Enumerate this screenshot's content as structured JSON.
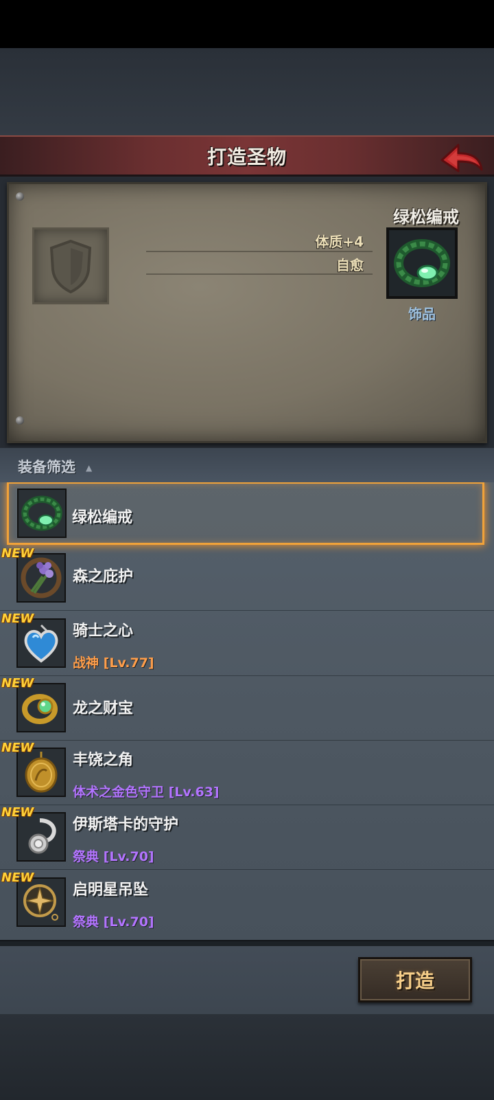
{
  "header": {
    "title": "打造圣物",
    "back_icon": "back-arrow-icon",
    "back_color": "#c0282a"
  },
  "preview": {
    "empty_slot_icon": "shield-icon",
    "item_name": "绿松编戒",
    "item_icon": "green-ring-icon",
    "item_type": "饰品",
    "stats": [
      "体质+4",
      "自愈"
    ]
  },
  "filter": {
    "label": "装备筛选",
    "toggle_symbol": "▲"
  },
  "items": [
    {
      "name": "绿松编戒",
      "icon": "green-ring-icon",
      "new": false,
      "selected": true,
      "sub": null
    },
    {
      "name": "森之庇护",
      "icon": "lavender-bundle-icon",
      "new": true,
      "selected": false,
      "sub": null
    },
    {
      "name": "骑士之心",
      "icon": "heart-pendant-icon",
      "new": true,
      "selected": false,
      "sub": {
        "text": "战神",
        "level": "[Lv.77]",
        "color": "orange"
      }
    },
    {
      "name": "龙之财宝",
      "icon": "gold-ring-icon",
      "new": true,
      "selected": false,
      "sub": null
    },
    {
      "name": "丰饶之角",
      "icon": "gold-medallion-icon",
      "new": true,
      "selected": false,
      "sub": {
        "text": "体术之金色守卫",
        "level": "[Lv.63]",
        "color": "purple"
      }
    },
    {
      "name": "伊斯塔卡的守护",
      "icon": "silver-amulet-icon",
      "new": true,
      "selected": false,
      "sub": {
        "text": "祭典",
        "level": "[Lv.70]",
        "color": "purple"
      }
    },
    {
      "name": "启明星吊坠",
      "icon": "compass-star-pendant-icon",
      "new": true,
      "selected": false,
      "sub": {
        "text": "祭典",
        "level": "[Lv.70]",
        "color": "purple"
      }
    }
  ],
  "new_badge": "NEW",
  "footer": {
    "forge_label": "打造"
  }
}
